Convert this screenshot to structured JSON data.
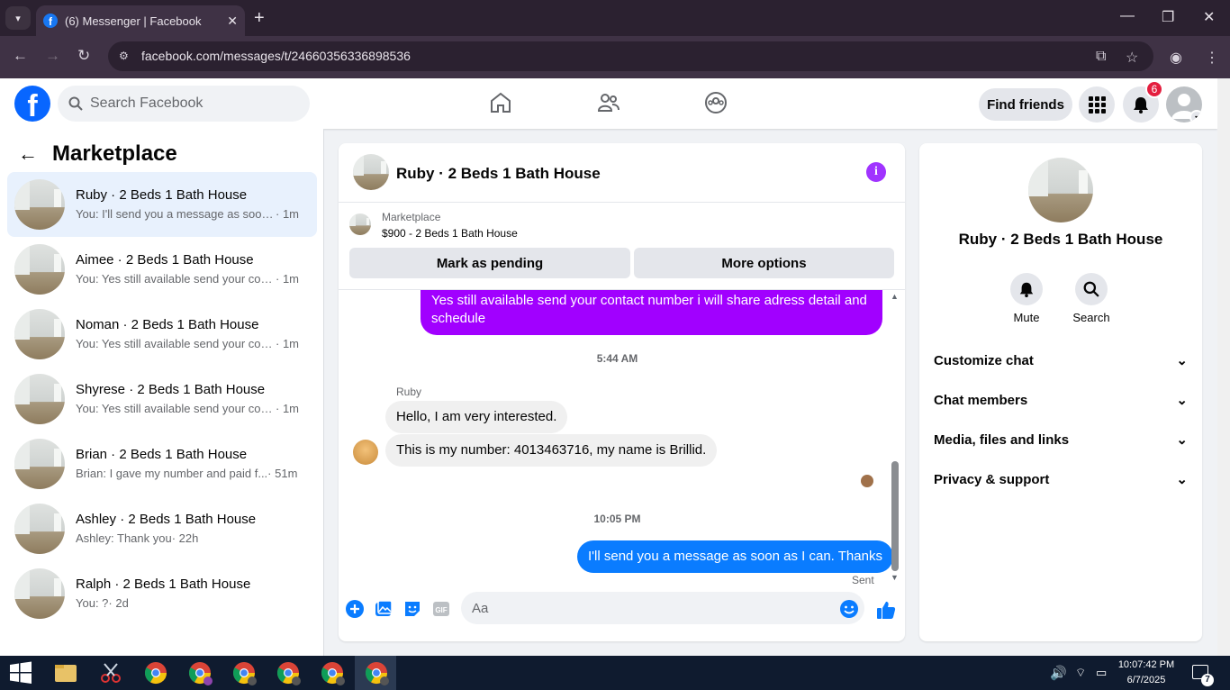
{
  "browser": {
    "tab_title": "(6) Messenger | Facebook",
    "url": "facebook.com/messages/t/24660356336898536"
  },
  "fb": {
    "search_placeholder": "Search Facebook",
    "find_friends": "Find friends",
    "notif_count": "6"
  },
  "left": {
    "title": "Marketplace",
    "conversations": [
      {
        "name": "Ruby · 2 Beds 1 Bath House",
        "preview": "You: I'll send you a message as soon ...",
        "time": " · 1m"
      },
      {
        "name": "Aimee · 2 Beds 1 Bath House",
        "preview": "You: Yes still available send your cont...",
        "time": " · 1m"
      },
      {
        "name": "Noman · 2 Beds 1 Bath House",
        "preview": "You: Yes still available send your cont...",
        "time": " · 1m"
      },
      {
        "name": "Shyrese · 2 Beds 1 Bath House",
        "preview": "You: Yes still available send your cont...",
        "time": " · 1m"
      },
      {
        "name": "Brian · 2 Beds 1 Bath House",
        "preview": "Brian: I gave my number and paid f...",
        "time": " · 51m"
      },
      {
        "name": "Ashley · 2 Beds 1 Bath House",
        "preview": "Ashley: Thank you",
        "time": " · 22h"
      },
      {
        "name": "Ralph · 2 Beds 1 Bath House",
        "preview": "You: ?",
        "time": " · 2d"
      }
    ]
  },
  "chat": {
    "title": "Ruby · 2 Beds 1 Bath House",
    "marketplace_label": "Marketplace",
    "listing": "$900 - 2 Beds 1 Bath House",
    "mark_pending": "Mark as pending",
    "more_options": "More options",
    "msg_out_1": "Yes still available send your contact number i will share adress detail and schedule",
    "time_1": "5:44 AM",
    "sender": "Ruby",
    "msg_in_1": "Hello, I am very interested.",
    "msg_in_2": "This is my number: 4013463716, my name is Brillid.",
    "time_2": "10:05 PM",
    "msg_out_2": "I'll send you a message as soon as I can. Thanks",
    "sent": "Sent",
    "composer_placeholder": "Aa"
  },
  "right": {
    "name": "Ruby · 2 Beds 1 Bath House",
    "mute": "Mute",
    "search": "Search",
    "rows": [
      "Customize chat",
      "Chat members",
      "Media, files and links",
      "Privacy & support"
    ]
  },
  "taskbar": {
    "time": "10:07:42 PM",
    "date": "6/7/2025",
    "notif": "7"
  },
  "colors": {
    "fb_blue": "#0866ff",
    "purple": "#a100ff",
    "msg_blue": "#0a7cff"
  }
}
